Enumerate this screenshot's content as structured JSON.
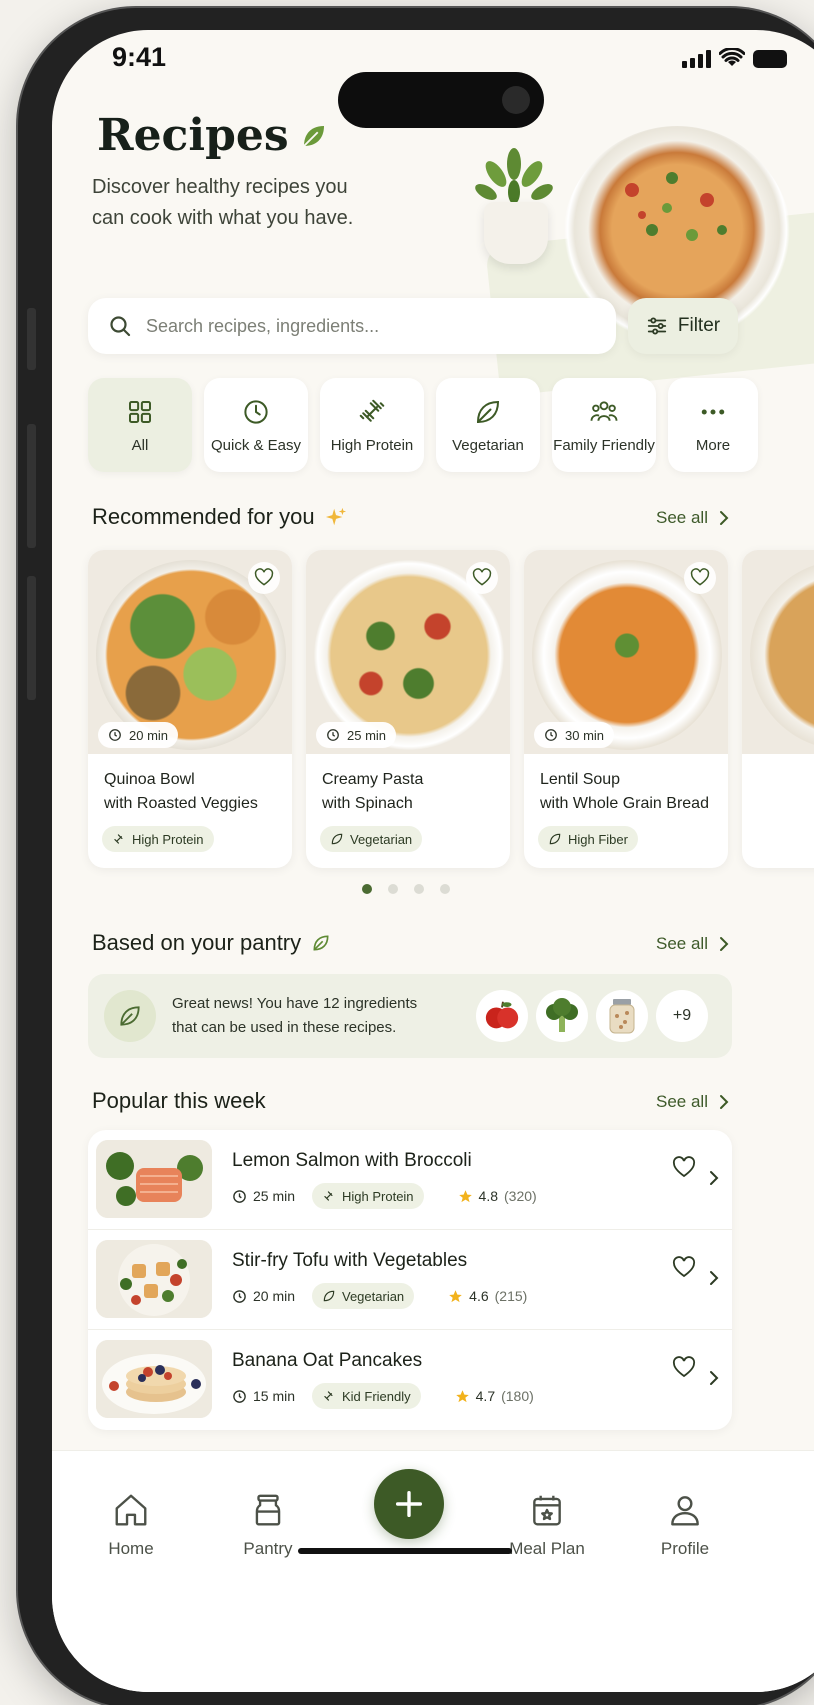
{
  "status_bar": {
    "time": "9:41"
  },
  "header": {
    "title": "Recipes",
    "subtitle_line1": "Discover healthy recipes you",
    "subtitle_line2": "can cook with what you have."
  },
  "search": {
    "placeholder": "Search recipes, ingredients...",
    "value": ""
  },
  "filter": {
    "label": "Filter"
  },
  "categories": [
    {
      "label": "All",
      "icon": "grid-icon",
      "active": true
    },
    {
      "label": "Quick & Easy",
      "icon": "clock-icon",
      "active": false
    },
    {
      "label": "High Protein",
      "icon": "dumbbell-icon",
      "active": false
    },
    {
      "label": "Vegetarian",
      "icon": "leaf-icon",
      "active": false
    },
    {
      "label": "Family Friendly",
      "icon": "family-icon",
      "active": false
    },
    {
      "label": "More",
      "icon": "more-dots-icon",
      "active": false
    }
  ],
  "recommended": {
    "title": "Recommended for you",
    "see_all": "See all",
    "cards": [
      {
        "time": "20 min",
        "name_line1": "Quinoa Bowl",
        "name_line2": "with Roasted Veggies",
        "tag": "High Protein",
        "tag_icon": "dumbbell-icon"
      },
      {
        "time": "25 min",
        "name_line1": "Creamy Pasta",
        "name_line2": "with Spinach",
        "tag": "Vegetarian",
        "tag_icon": "leaf-icon"
      },
      {
        "time": "30 min",
        "name_line1": "Lentil Soup",
        "name_line2": "with Whole Grain Bread",
        "tag": "High Fiber",
        "tag_icon": "leaf-icon"
      }
    ],
    "carousel_pages": 4,
    "carousel_active_index": 0
  },
  "pantry": {
    "title": "Based on your pantry",
    "see_all": "See all",
    "message_line1": "Great news! You have 12 ingredients",
    "message_line2": "that can be used in these recipes.",
    "more_count": "+9"
  },
  "popular": {
    "title": "Popular this week",
    "see_all": "See all",
    "items": [
      {
        "name": "Lemon Salmon with Broccoli",
        "time": "25 min",
        "tag": "High Protein",
        "tag_icon": "dumbbell-icon",
        "rating": "4.8",
        "reviews": "(320)"
      },
      {
        "name": "Stir-fry Tofu with Vegetables",
        "time": "20 min",
        "tag": "Vegetarian",
        "tag_icon": "leaf-icon",
        "rating": "4.6",
        "reviews": "(215)"
      },
      {
        "name": "Banana Oat Pancakes",
        "time": "15 min",
        "tag": "Kid Friendly",
        "tag_icon": "dumbbell-icon",
        "rating": "4.7",
        "reviews": "(180)"
      }
    ]
  },
  "tabbar": {
    "home": "Home",
    "pantry": "Pantry",
    "meal_plan": "Meal Plan",
    "profile": "Profile"
  },
  "colors": {
    "accent": "#3d5a26",
    "accent_soft": "#ecefe1",
    "star": "#f2b21c",
    "background": "#faf8f3"
  }
}
